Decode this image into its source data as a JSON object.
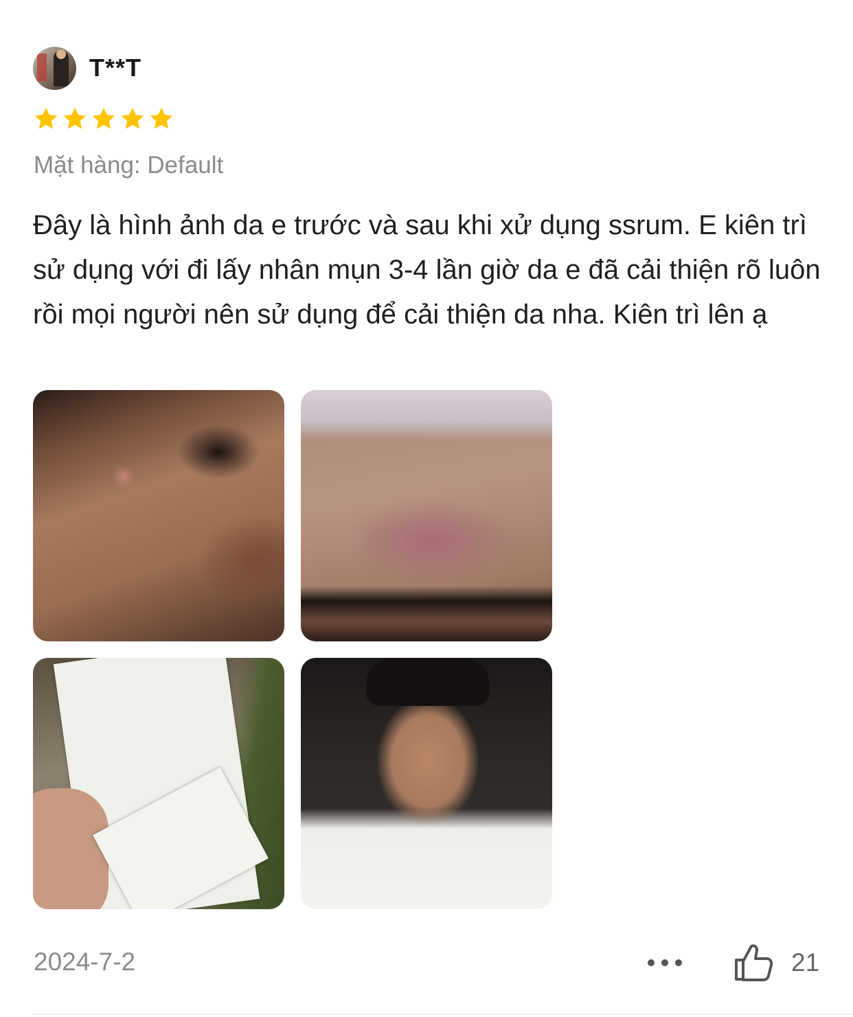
{
  "review": {
    "user": {
      "name": "T**T",
      "avatar_icon": "user-avatar"
    },
    "rating": {
      "value": 5,
      "max": 5,
      "star_color": "#FFC400"
    },
    "variant_label": "Mặt hàng: Default",
    "text": "Đây là hình ảnh da e trước và sau khi xử dụng ssrum. E kiên trì sử dụng với đi lấy nhân mụn 3-4 lần giờ da e đã cải thiện rõ luôn rồi mọi người nên sử dụng để cải thiện da nha. Kiên trì lên ạ",
    "photos": [
      {
        "name": "review-photo-1"
      },
      {
        "name": "review-photo-2"
      },
      {
        "name": "review-photo-3"
      },
      {
        "name": "review-photo-4"
      }
    ],
    "date": "2024-7-2",
    "like_count": "21",
    "icons": {
      "more": "more-icon",
      "like": "thumbs-up-icon"
    }
  }
}
